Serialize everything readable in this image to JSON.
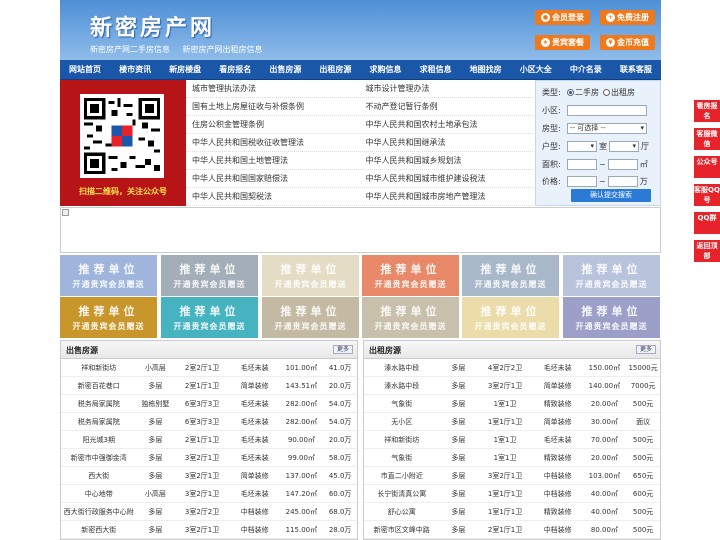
{
  "header": {
    "logo": "新密房产网",
    "sub_links": [
      "新密房产网二手房信息",
      "新密房产网出租房信息"
    ],
    "buttons": [
      {
        "label": "会员登录",
        "icon": "user-icon"
      },
      {
        "label": "免费注册",
        "icon": "register-icon"
      },
      {
        "label": "贵宾套餐",
        "icon": "vip-icon"
      },
      {
        "label": "金币充值",
        "icon": "coin-icon"
      }
    ]
  },
  "nav": [
    "网站首页",
    "楼市资讯",
    "新房楼盘",
    "看房报名",
    "出售房源",
    "出租房源",
    "求购信息",
    "求租信息",
    "地图找房",
    "小区大全",
    "中介名录",
    "联系客服"
  ],
  "qr": {
    "caption": "扫描二维码，关注公众号"
  },
  "links": [
    [
      "城市管理执法办法",
      "城市设计管理办法"
    ],
    [
      "国有土地上房屋征收与补偿条例",
      "不动产登记暂行条例"
    ],
    [
      "住房公积金管理条例",
      "中华人民共和国农村土地承包法"
    ],
    [
      "中华人民共和国税收征收管理法",
      "中华人民共和国继承法"
    ],
    [
      "中华人民共和国土地管理法",
      "中华人民共和国城乡规划法"
    ],
    [
      "中华人民共和国国家赔偿法",
      "中华人民共和国城市维护建设税法"
    ],
    [
      "中华人民共和国契税法",
      "中华人民共和国城市房地产管理法"
    ]
  ],
  "search": {
    "type_label": "类型:",
    "type_options": [
      "二手房",
      "出租房"
    ],
    "community_label": "小区:",
    "room_label": "房型:",
    "room_value": "-- 可选择 --",
    "layout_label": "户型:",
    "layout_units": [
      "室",
      "厅"
    ],
    "area_label": "面积:",
    "area_unit": "㎡",
    "price_label": "价格:",
    "price_unit": "万",
    "range_sep": "~",
    "submit": "确认提交搜索"
  },
  "tiles": {
    "line1": "推荐单位",
    "line2": "开通贵宾会员赠送",
    "colors": [
      "#9fb5dc",
      "#a3aeb8",
      "#e4dcc4",
      "#e88a6a",
      "#a8b8c8",
      "#b8c4dc",
      "#c8962a",
      "#46b3c0",
      "#c4baa4",
      "#c8c0aa",
      "#ecdcaa",
      "#9ca0c8"
    ]
  },
  "sale": {
    "title": "出售房源",
    "more": "更多",
    "rows": [
      [
        "祥和新街坊",
        "小高层",
        "2室2厅1卫",
        "毛坯未装",
        "101.00㎡",
        "41.0万"
      ],
      [
        "新密百花巷口",
        "多层",
        "2室1厅1卫",
        "简单装修",
        "143.51㎡",
        "20.0万"
      ],
      [
        "税务局家属院",
        "独栋别墅",
        "6室3厅3卫",
        "毛坯未装",
        "282.00㎡",
        "54.0万"
      ],
      [
        "税务局家属院",
        "多层",
        "6室3厅3卫",
        "毛坯未装",
        "282.00㎡",
        "54.0万"
      ],
      [
        "阳光城3期",
        "多层",
        "2室1厅1卫",
        "毛坯未装",
        "90.00㎡",
        "20.0万"
      ],
      [
        "新密市中强御金湾",
        "多层",
        "3室2厅1卫",
        "毛坯未装",
        "99.00㎡",
        "58.0万"
      ],
      [
        "西大街",
        "多层",
        "3室2厅1卫",
        "简单装修",
        "137.00㎡",
        "45.0万"
      ],
      [
        "中心地带",
        "小高层",
        "3室2厅1卫",
        "毛坯未装",
        "147.20㎡",
        "60.0万"
      ],
      [
        "西大街行政服务中心附",
        "多层",
        "3室2厅2卫",
        "中档装修",
        "245.00㎡",
        "68.0万"
      ],
      [
        "新密西大街",
        "多层",
        "3室2厅1卫",
        "中档装修",
        "115.00㎡",
        "28.0万"
      ]
    ]
  },
  "rent": {
    "title": "出租房源",
    "more": "更多",
    "rows": [
      [
        "溱水路中段",
        "多层",
        "4室2厅2卫",
        "毛坯未装",
        "150.00㎡",
        "15000元"
      ],
      [
        "溱水路中段",
        "多层",
        "3室2厅1卫",
        "简单装修",
        "140.00㎡",
        "7000元"
      ],
      [
        "气象街",
        "多层",
        "1室1卫",
        "精致装修",
        "20.00㎡",
        "500元"
      ],
      [
        "无小区",
        "多层",
        "1室1厅1卫",
        "简单装修",
        "30.00㎡",
        "面议"
      ],
      [
        "祥和新街坊",
        "多层",
        "1室1卫",
        "毛坯未装",
        "70.00㎡",
        "500元"
      ],
      [
        "气象街",
        "多层",
        "1室1卫",
        "精致装修",
        "20.00㎡",
        "500元"
      ],
      [
        "市直二小附近",
        "多层",
        "3室2厅1卫",
        "中档装修",
        "103.00㎡",
        "650元"
      ],
      [
        "长宁街清真公寓",
        "多层",
        "1室1厅1卫",
        "中档装修",
        "40.00㎡",
        "600元"
      ],
      [
        "舒心公寓",
        "多层",
        "1室1厅1卫",
        "精致装修",
        "40.00㎡",
        "500元"
      ],
      [
        "新密市区文峰中路",
        "多层",
        "2室1厅1卫",
        "中档装修",
        "80.00㎡",
        "500元"
      ]
    ]
  },
  "float": [
    "看房报名",
    "客服微信",
    "公众号",
    "客服QQ号",
    "QQ群",
    "返回顶部"
  ]
}
